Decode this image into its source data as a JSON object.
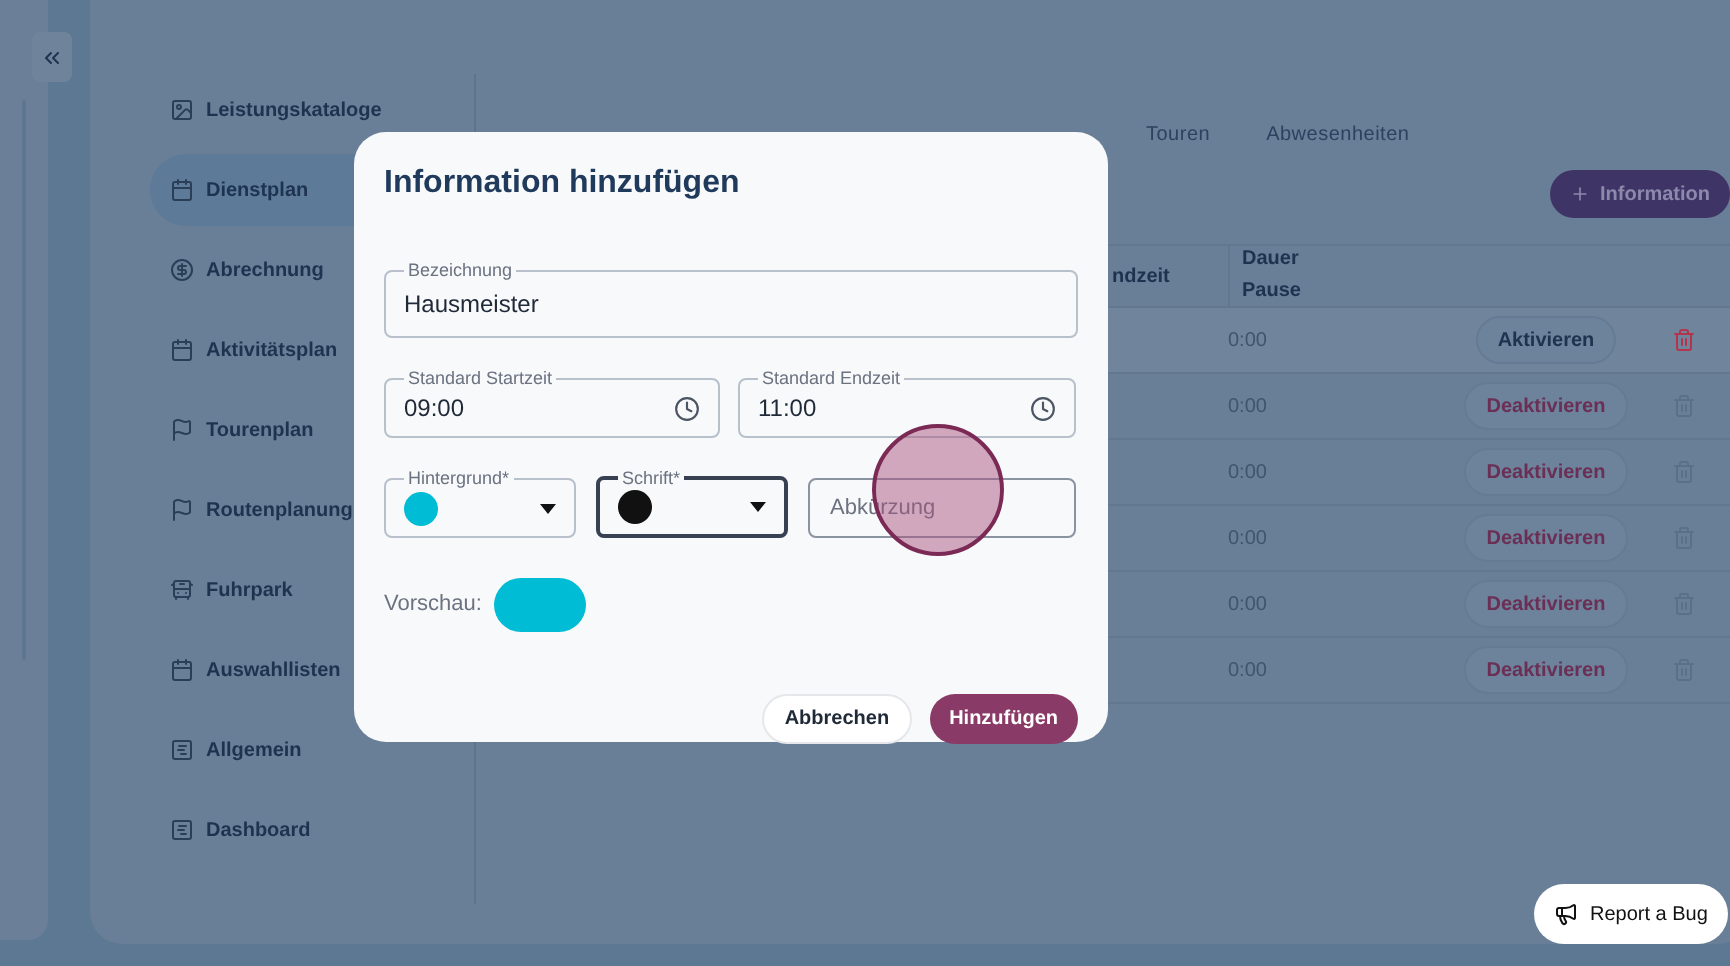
{
  "sidebar": {
    "items": [
      {
        "label": "Leistungskataloge",
        "selected": false
      },
      {
        "label": "Dienstplan",
        "selected": true
      },
      {
        "label": "Abrechnung",
        "selected": false
      },
      {
        "label": "Aktivitätsplan",
        "selected": false
      },
      {
        "label": "Tourenplan",
        "selected": false
      },
      {
        "label": "Routenplanung",
        "selected": false
      },
      {
        "label": "Fuhrpark",
        "selected": false
      },
      {
        "label": "Auswahllisten",
        "selected": false
      },
      {
        "label": "Allgemein",
        "selected": false
      },
      {
        "label": "Dashboard",
        "selected": false
      }
    ]
  },
  "tabs": [
    {
      "label": "Touren",
      "selected": false
    },
    {
      "label": "Abwesenheiten",
      "selected": false
    }
  ],
  "add_button": "Information",
  "table": {
    "columns": [
      "ndzeit",
      "Dauer Pause"
    ],
    "rows": [
      {
        "duration": "0:00",
        "action": "Aktivieren",
        "active": false
      },
      {
        "duration": "0:00",
        "action": "Deaktivieren",
        "active": true
      },
      {
        "duration": "0:00",
        "action": "Deaktivieren",
        "active": true
      },
      {
        "duration": "0:00",
        "action": "Deaktivieren",
        "active": true
      },
      {
        "duration": "0:00",
        "action": "Deaktivieren",
        "active": true
      },
      {
        "duration": "0:00",
        "action": "Deaktivieren",
        "active": true
      }
    ]
  },
  "dialog": {
    "title": "Information hinzufügen",
    "name_field": {
      "label": "Bezeichnung",
      "value": "Hausmeister"
    },
    "start_field": {
      "label": "Standard Startzeit",
      "value": "09:00"
    },
    "end_field": {
      "label": "Standard Endzeit",
      "value": "11:00"
    },
    "background_select": {
      "label": "Hintergrund*",
      "color": "#00bcd4",
      "focused": false
    },
    "font_select": {
      "label": "Schrift*",
      "color": "#111111",
      "focused": true
    },
    "abbreviation_field": {
      "placeholder": "Abkürzung"
    },
    "preview_label": "Vorschau:",
    "buttons": [
      {
        "label": "Abbrechen",
        "kind": "secondary"
      },
      {
        "label": "Hinzufügen",
        "kind": "primary"
      }
    ]
  },
  "report_button": "Report a Bug"
}
